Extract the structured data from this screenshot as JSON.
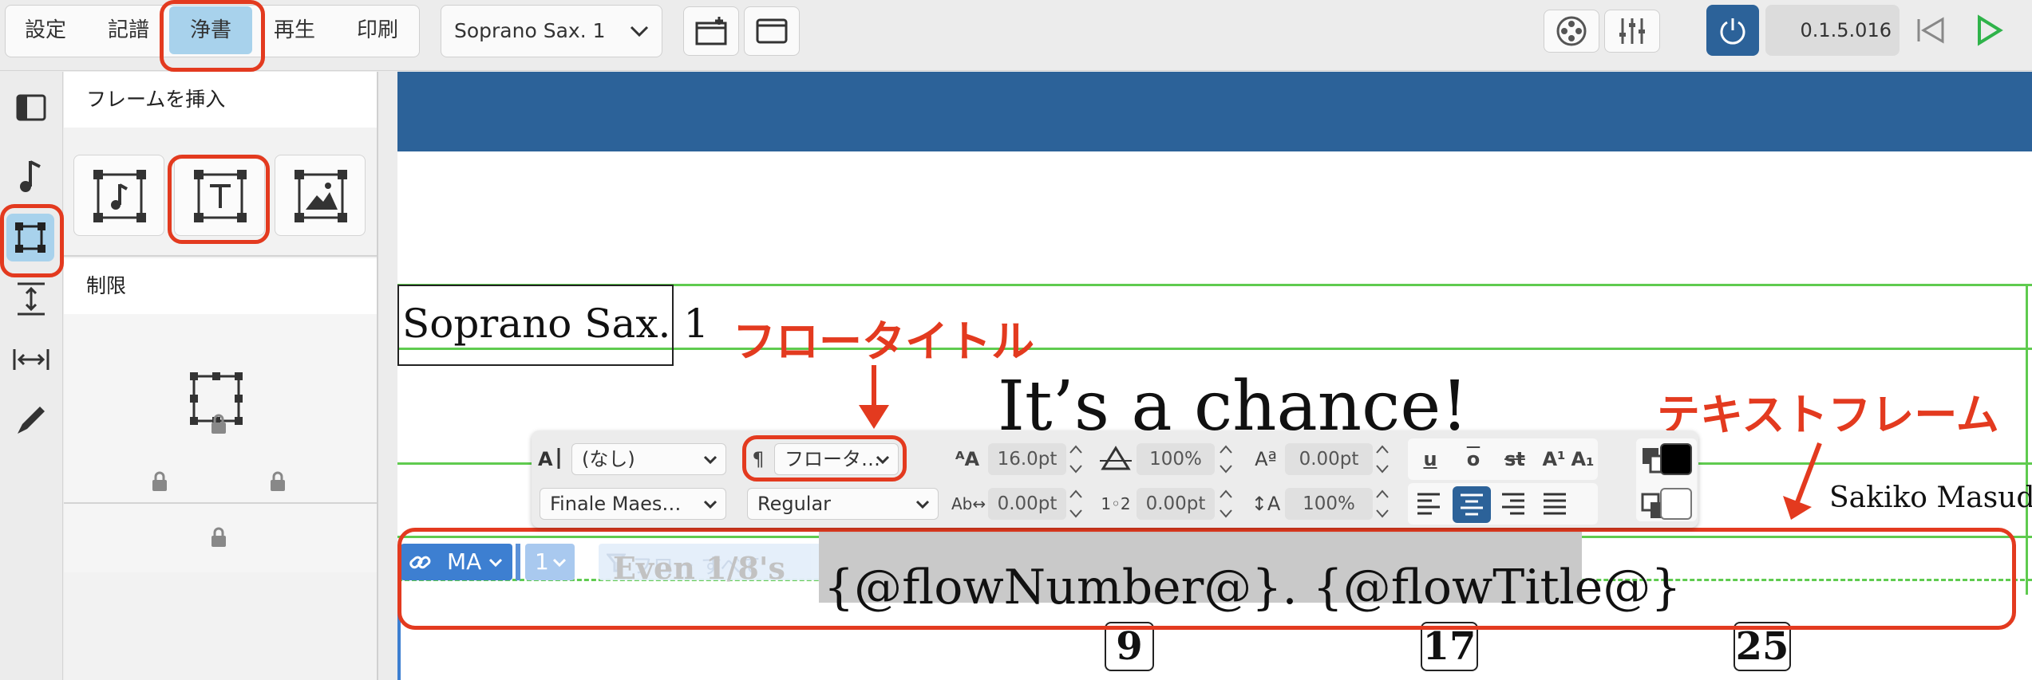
{
  "modes": [
    "設定",
    "記譜",
    "浄書",
    "再生",
    "印刷"
  ],
  "selected_mode": "浄書",
  "layout_selector": {
    "value": "Soprano Sax. 1"
  },
  "version": "0.1.5.016",
  "panel": {
    "insert_frame_heading": "フレームを挿入",
    "constraints_heading": "制限"
  },
  "score": {
    "part_name": "Soprano Sax. 1",
    "title": "It’s a chance!",
    "composer": "Sakiko Masuda",
    "flow_frame_text": "{@flowNumber@}. {@flowTitle@}",
    "faded_text": "Even 1/8's",
    "faded_text_2": "フロー すべて",
    "chain_label": "MA",
    "page_num_label": "1",
    "bar_numbers": [
      "9",
      "17",
      "25"
    ]
  },
  "annotations": {
    "flow_title": "フロータイトル",
    "text_frame": "テキストフレーム"
  },
  "text_toolbar": {
    "paragraph_style": "(なし)",
    "flow_style": "フロータ…",
    "font_size": "16.0pt",
    "scale": "100%",
    "baseline": "0.00pt",
    "font_family": "Finale Maes…",
    "font_weight": "Regular",
    "char_spacing": "0.00pt",
    "word_spacing": "0.00pt",
    "line_spacing": "100%",
    "underline": "u",
    "overline": "o",
    "strikethrough": "st",
    "superscript": "A¹",
    "subscript": "A₁"
  },
  "colors": {
    "accent_blue": "#2c6299",
    "selected_mode_bg": "#a8d2ec",
    "annotation_red": "#e33a1f",
    "frame_green": "#5fcb4f",
    "play_green": "#2fb34a"
  }
}
